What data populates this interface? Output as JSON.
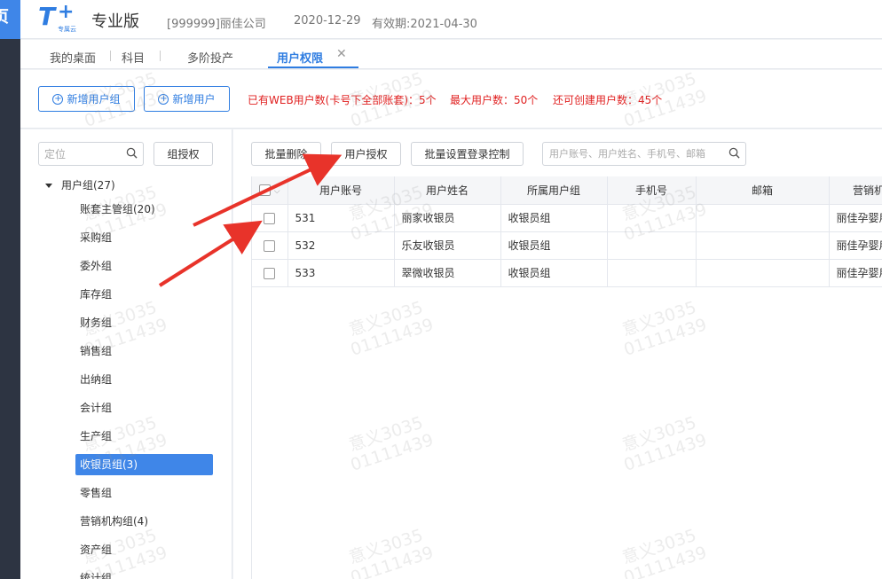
{
  "side": {
    "logo_char": "页"
  },
  "header": {
    "brand_sub": "专属云",
    "edition": "专业版",
    "company": "[999999]丽佳公司",
    "date": "2020-12-29",
    "validity": "有效期:2021-04-30"
  },
  "tabs": [
    {
      "label": "我的桌面"
    },
    {
      "label": "科目"
    },
    {
      "label": "多阶投产"
    },
    {
      "label": "用户权限",
      "active": true,
      "close": "✕"
    }
  ],
  "toolbar": {
    "add_group": "新增用户组",
    "add_user": "新增用户",
    "web_users": "已有WEB用户数(卡号下全部账套)：5个",
    "max_users": "最大用户数：50个",
    "remaining": "还可创建用户数：45个"
  },
  "left": {
    "search_placeholder": "定位",
    "group_auth": "组授权",
    "root": "用户组(27)",
    "items": [
      "账套主管组(20)",
      "采购组",
      "委外组",
      "库存组",
      "财务组",
      "销售组",
      "出纳组",
      "会计组",
      "生产组",
      "收银员组(3)",
      "零售组",
      "营销机构组(4)",
      "资产组",
      "统计组"
    ],
    "selected_index": 9
  },
  "main": {
    "batch_delete": "批量删除",
    "user_auth": "用户授权",
    "batch_login": "批量设置登录控制",
    "search_placeholder": "用户账号、用户姓名、手机号、邮箱",
    "columns": [
      "",
      "用户账号",
      "用户姓名",
      "所属用户组",
      "手机号",
      "邮箱",
      "营销机"
    ],
    "rows": [
      {
        "account": "531",
        "name": "丽家收银员",
        "group": "收银员组",
        "phone": "",
        "email": "",
        "org": "丽佳孕婴用"
      },
      {
        "account": "532",
        "name": "乐友收银员",
        "group": "收银员组",
        "phone": "",
        "email": "",
        "org": "丽佳孕婴用"
      },
      {
        "account": "533",
        "name": "翠微收银员",
        "group": "收银员组",
        "phone": "",
        "email": "",
        "org": "丽佳孕婴用"
      }
    ]
  },
  "watermark": {
    "line1": "意义3035",
    "line2": "01111439"
  },
  "colors": {
    "accent": "#2f7de1",
    "selected": "#3f86e8",
    "warning": "#e02020",
    "arrow": "#e8332a"
  }
}
